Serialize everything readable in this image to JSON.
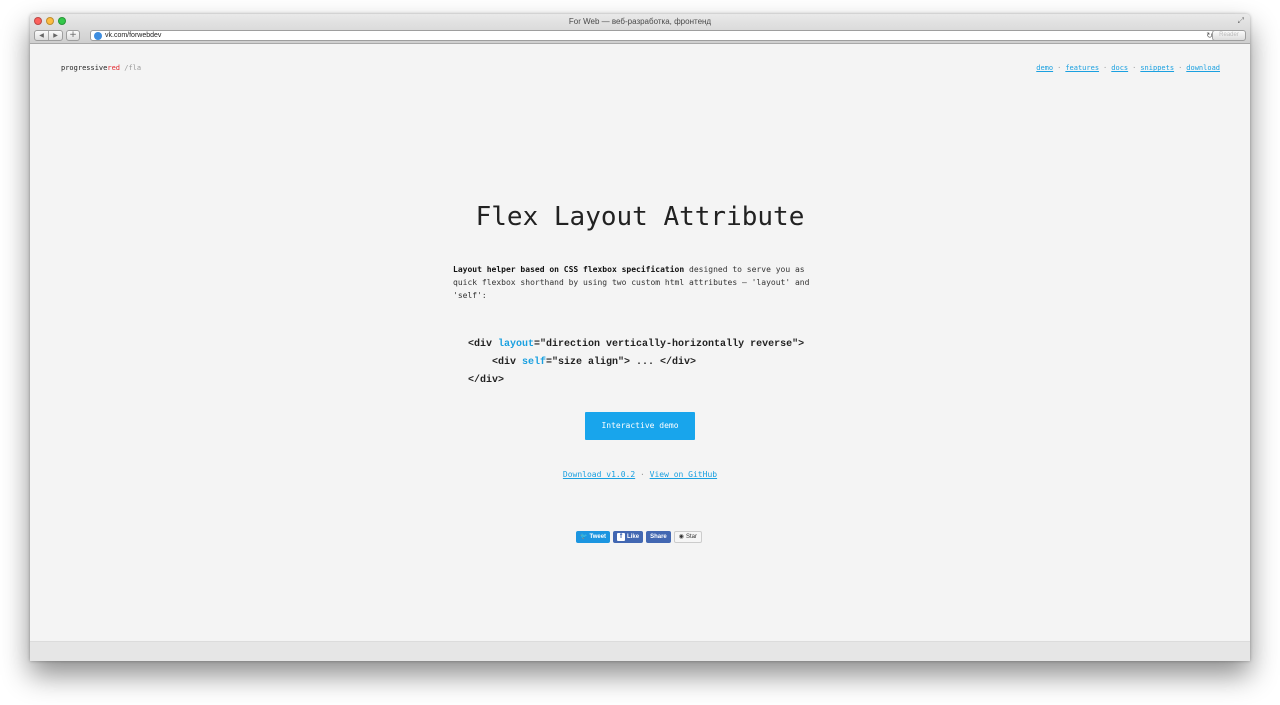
{
  "browser": {
    "title": "For Web — веб-разработка, фронтенд",
    "url": "vk.com/forwebdev",
    "reader_label": "Reader",
    "new_tab_label": "+"
  },
  "site": {
    "logo": {
      "part1": "progressive",
      "part2": "red",
      "part3": " /fla"
    },
    "nav": [
      "demo",
      "features",
      "docs",
      "snippets",
      "download"
    ],
    "nav_separator": "·",
    "headline": "Flex Layout Attribute",
    "intro_bold": "Layout helper based on CSS flexbox specification",
    "intro_rest": " designed to serve you as quick flexbox shorthand by using two custom html attributes — 'layout' and 'self':",
    "code": {
      "line1_a": "<div ",
      "line1_attr": "layout",
      "line1_b": "=\"direction vertically-horizontally reverse\">",
      "line2_a": "    <div ",
      "line2_attr": "self",
      "line2_b": "=\"size align\"> ... </div>",
      "line3": "</div>"
    },
    "demo_button": "Interactive demo",
    "download_link": "Download v1.0.2",
    "github_link": "View on GitHub",
    "link_separator": "·",
    "social": {
      "tweet": "Tweet",
      "like": "Like",
      "share": "Share",
      "star": "Star"
    }
  },
  "colors": {
    "accent": "#18a5ec",
    "logo_red": "#e2262c",
    "background": "#f4f4f4"
  }
}
